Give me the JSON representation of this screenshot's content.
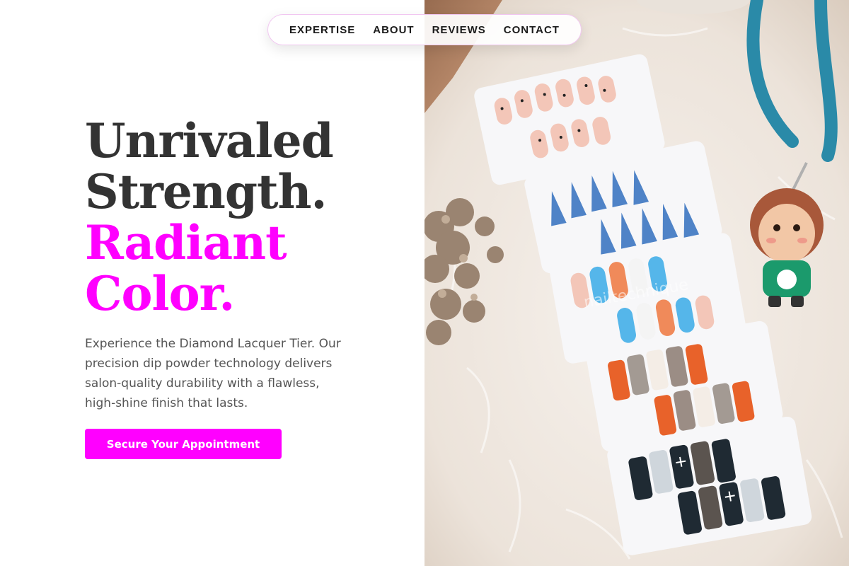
{
  "nav": {
    "items": [
      {
        "label": "EXPERTISE"
      },
      {
        "label": "ABOUT"
      },
      {
        "label": "REVIEWS"
      },
      {
        "label": "CONTACT"
      }
    ]
  },
  "hero": {
    "line1": "Unrivaled",
    "line2": "Strength.",
    "line3": "Radiant",
    "line4": "Color.",
    "description": "Experience the Diamond Lacquer Tier. Our precision dip powder technology delivers salon-quality durability with a flawless, high-shine finish that lasts.",
    "cta_label": "Secure Your Appointment"
  },
  "photo": {
    "watermark": "nailtechnique"
  },
  "colors": {
    "accent": "#ff00ff",
    "heading_dark": "#333333",
    "body_text": "#555555"
  }
}
